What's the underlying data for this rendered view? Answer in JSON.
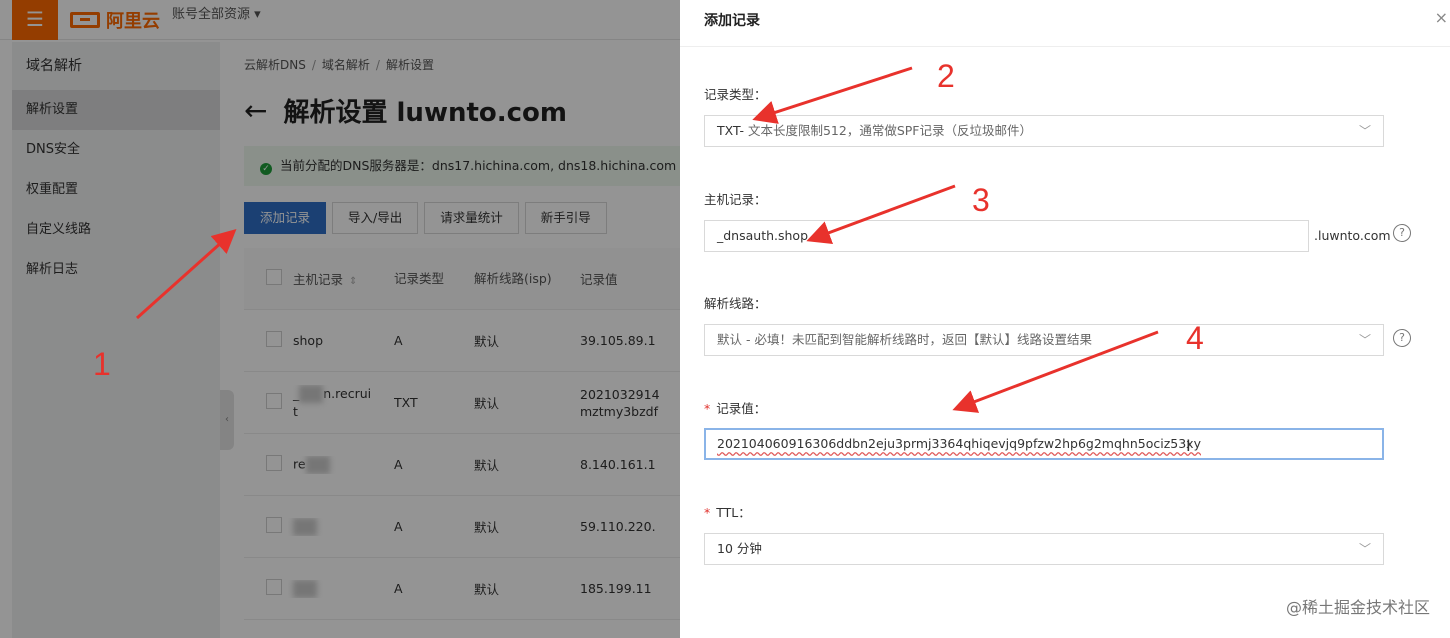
{
  "topbar": {
    "menu_icon": "☰",
    "logo_text": "阿里云",
    "account_label": "账号全部资源 ▾"
  },
  "sidebar": {
    "title": "域名解析",
    "items": [
      {
        "label": "解析设置",
        "active": true
      },
      {
        "label": "DNS安全"
      },
      {
        "label": "权重配置"
      },
      {
        "label": "自定义线路"
      },
      {
        "label": "解析日志"
      }
    ]
  },
  "main": {
    "breadcrumb": [
      "云解析DNS",
      "域名解析",
      "解析设置"
    ],
    "title": "解析设置 luwnto.com",
    "notice": "当前分配的DNS服务器是：dns17.hichina.com, dns18.hichina.com",
    "toolbar": [
      "添加记录",
      "导入/导出",
      "请求量统计",
      "新手引导"
    ],
    "table": {
      "headers": [
        "主机记录",
        "记录类型",
        "解析线路(isp)",
        "记录值"
      ],
      "rows": [
        {
          "host": "shop",
          "type": "A",
          "line": "默认",
          "value": "39.105.89.1"
        },
        {
          "host_a": "_",
          "host_b": "n.recrui",
          "host_c": "t",
          "type": "TXT",
          "line": "默认",
          "value_a": "2021032914",
          "value_b": "mztmy3bzdf"
        },
        {
          "host": "re",
          "type": "A",
          "line": "默认",
          "value": "8.140.161.1"
        },
        {
          "host": "",
          "type": "A",
          "line": "默认",
          "value": "59.110.220."
        },
        {
          "host": "",
          "type": "A",
          "line": "默认",
          "value": "185.199.11"
        }
      ]
    }
  },
  "drawer": {
    "title": "添加记录",
    "close_icon": "×",
    "record_type": {
      "label": "记录类型：",
      "value": "TXT-",
      "hint": "文本长度限制512，通常做SPF记录（反垃圾邮件）"
    },
    "host": {
      "label": "主机记录：",
      "value": "_dnsauth.shop",
      "suffix": ".luwnto.com"
    },
    "line": {
      "label": "解析线路：",
      "value": "默认 - 必填！未匹配到智能解析线路时，返回【默认】线路设置结果"
    },
    "record_value": {
      "required": "*",
      "label": "记录值：",
      "value": "202104060916306ddbn2eju3prmj3364qhiqevjq9pfzw2hp6g2mqhn5ociz53xy"
    },
    "ttl": {
      "required": "*",
      "label": "TTL：",
      "value": "10 分钟"
    }
  },
  "annotations": [
    "1",
    "2",
    "3",
    "4"
  ],
  "watermark": "@稀土掘金技术社区",
  "colors": {
    "brand": "#ff6a00",
    "primary": "#2f6fc6",
    "arrow": "#e8322c"
  }
}
